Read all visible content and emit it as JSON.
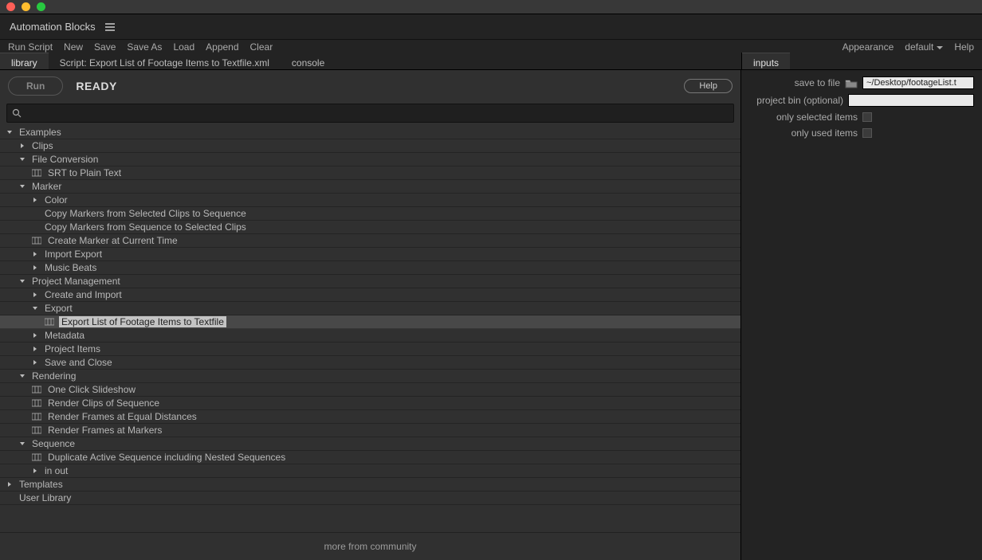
{
  "panel_title": "Automation Blocks",
  "menu": {
    "left": [
      "Run Script",
      "New",
      "Save",
      "Save As",
      "Load",
      "Append",
      "Clear"
    ],
    "right": {
      "appearance": "Appearance",
      "preset": "default",
      "help": "Help"
    }
  },
  "tabs": {
    "library": "library",
    "script": "Script: Export List of Footage Items to Textfile.xml",
    "console": "console",
    "inputs": "inputs"
  },
  "runbar": {
    "run": "Run",
    "status": "READY",
    "help": "Help"
  },
  "community_link": "more from community",
  "tree": [
    {
      "d": 0,
      "t": "folder-open",
      "label": "Examples"
    },
    {
      "d": 1,
      "t": "folder-closed",
      "label": "Clips"
    },
    {
      "d": 1,
      "t": "folder-open",
      "label": "File Conversion"
    },
    {
      "d": 2,
      "t": "leaf",
      "label": "SRT to Plain Text"
    },
    {
      "d": 1,
      "t": "folder-open",
      "label": "Marker"
    },
    {
      "d": 2,
      "t": "folder-closed",
      "label": "Color"
    },
    {
      "d": 2,
      "t": "text",
      "label": "Copy Markers from Selected Clips to Sequence"
    },
    {
      "d": 2,
      "t": "text",
      "label": "Copy Markers from Sequence to Selected Clips"
    },
    {
      "d": 2,
      "t": "leaf",
      "label": "Create Marker at Current Time"
    },
    {
      "d": 2,
      "t": "folder-closed",
      "label": "Import Export"
    },
    {
      "d": 2,
      "t": "folder-closed",
      "label": "Music Beats"
    },
    {
      "d": 1,
      "t": "folder-open",
      "label": "Project Management"
    },
    {
      "d": 2,
      "t": "folder-closed",
      "label": "Create and Import"
    },
    {
      "d": 2,
      "t": "folder-open",
      "label": "Export"
    },
    {
      "d": 3,
      "t": "leaf",
      "label": "Export List of Footage Items to Textfile",
      "selected": true
    },
    {
      "d": 2,
      "t": "folder-closed",
      "label": "Metadata"
    },
    {
      "d": 2,
      "t": "folder-closed",
      "label": "Project Items"
    },
    {
      "d": 2,
      "t": "folder-closed",
      "label": "Save and Close"
    },
    {
      "d": 1,
      "t": "folder-open",
      "label": "Rendering"
    },
    {
      "d": 2,
      "t": "leaf",
      "label": "One Click Slideshow"
    },
    {
      "d": 2,
      "t": "leaf",
      "label": "Render Clips of Sequence"
    },
    {
      "d": 2,
      "t": "leaf",
      "label": "Render Frames at Equal Distances"
    },
    {
      "d": 2,
      "t": "leaf",
      "label": "Render Frames at Markers"
    },
    {
      "d": 1,
      "t": "folder-open",
      "label": "Sequence"
    },
    {
      "d": 2,
      "t": "leaf",
      "label": "Duplicate Active Sequence including Nested Sequences"
    },
    {
      "d": 2,
      "t": "folder-closed",
      "label": "in out"
    },
    {
      "d": 0,
      "t": "folder-closed",
      "label": "Templates"
    },
    {
      "d": 0,
      "t": "text",
      "label": "User Library"
    }
  ],
  "inputs_form": {
    "save_to_file": {
      "label": "save to file",
      "value": "~/Desktop/footageList.t"
    },
    "project_bin": {
      "label": "project bin (optional)",
      "value": ""
    },
    "only_selected": {
      "label": "only selected items"
    },
    "only_used": {
      "label": "only used items"
    }
  }
}
